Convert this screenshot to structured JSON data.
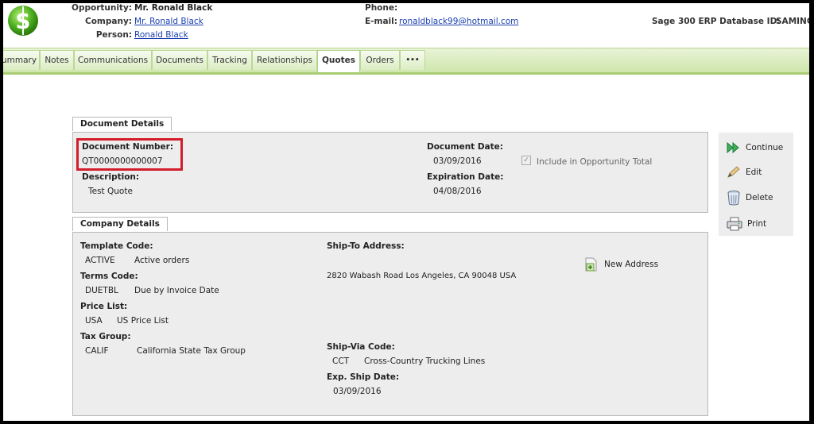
{
  "header": {
    "opportunity_label": "Opportunity:",
    "opportunity_value": "Mr. Ronald Black",
    "company_label": "Company:",
    "company_value": "Mr. Ronald Black",
    "person_label": "Person:",
    "person_value": "Ronald Black",
    "phone_label": "Phone:",
    "phone_value": "",
    "email_label": "E-mail:",
    "email_value": "ronaldblack99@hotmail.com",
    "db_label": "Sage 300 ERP Database ID:",
    "db_value": "SAMINC"
  },
  "tabs": [
    {
      "label": "ummary"
    },
    {
      "label": "Notes"
    },
    {
      "label": "Communications"
    },
    {
      "label": "Documents"
    },
    {
      "label": "Tracking"
    },
    {
      "label": "Relationships"
    },
    {
      "label": "Quotes"
    },
    {
      "label": "Orders"
    },
    {
      "label": "•••"
    }
  ],
  "active_tab": "Quotes",
  "document_details": {
    "section_title": "Document Details",
    "number_label": "Document Number:",
    "number_value": "QT0000000000007",
    "description_label": "Description:",
    "description_value": "Test Quote",
    "date_label": "Document Date:",
    "date_value": "03/09/2016",
    "expiration_label": "Expiration Date:",
    "expiration_value": "04/08/2016",
    "include_label": "Include in Opportunity Total",
    "include_checked": true
  },
  "company_details": {
    "section_title": "Company Details",
    "template_label": "Template Code:",
    "template_code": "ACTIVE",
    "template_desc": "Active orders",
    "terms_label": "Terms Code:",
    "terms_code": "DUETBL",
    "terms_desc": "Due by Invoice Date",
    "price_label": "Price List:",
    "price_code": "USA",
    "price_desc": "US Price List",
    "tax_label": "Tax Group:",
    "tax_code": "CALIF",
    "tax_desc": "California State Tax Group",
    "shipto_label": "Ship-To Address:",
    "shipto_value": "2820 Wabash Road Los Angeles, CA 90048 USA",
    "new_address_label": "New Address",
    "shipvia_label": "Ship-Via Code:",
    "shipvia_code": "CCT",
    "shipvia_desc": "Cross-Country Trucking Lines",
    "shipdate_label": "Exp. Ship Date:",
    "shipdate_value": "03/09/2016"
  },
  "actions": {
    "continue": "Continue",
    "edit": "Edit",
    "delete": "Delete",
    "print": "Print"
  },
  "colors": {
    "accent_green": "#a9cc72",
    "highlight_red": "#d21d2a",
    "link_blue": "#1a3fb0"
  }
}
